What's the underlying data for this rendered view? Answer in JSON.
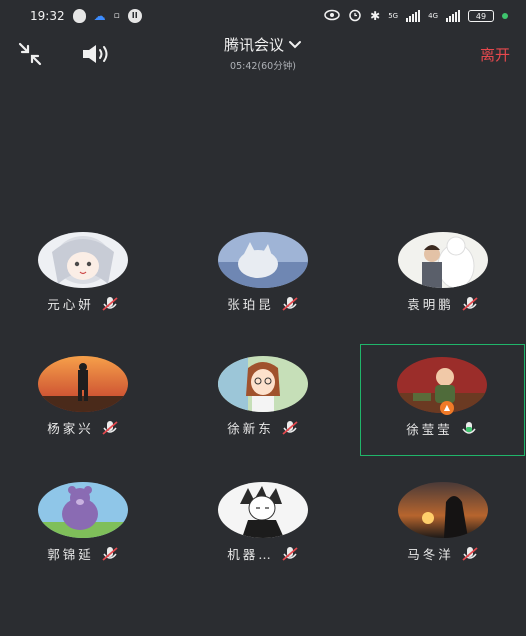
{
  "status_bar": {
    "time": "19:32",
    "network_1": "5G",
    "network_2": "4G",
    "battery": "49"
  },
  "header": {
    "title": "腾讯会议",
    "duration": "05:42(60分钟)",
    "leave_label": "离开"
  },
  "participants": [
    {
      "name": "元心妍",
      "muted": true,
      "speaking": false
    },
    {
      "name": "张珀昆",
      "muted": true,
      "speaking": false
    },
    {
      "name": "袁明鹏",
      "muted": true,
      "speaking": false
    },
    {
      "name": "杨家兴",
      "muted": true,
      "speaking": false
    },
    {
      "name": "徐新东",
      "muted": true,
      "speaking": false
    },
    {
      "name": "徐莹莹",
      "muted": false,
      "speaking": true
    },
    {
      "name": "郭锦延",
      "muted": true,
      "speaking": false
    },
    {
      "name": "机器…",
      "muted": true,
      "speaking": false
    },
    {
      "name": "马冬洋",
      "muted": true,
      "speaking": false
    }
  ],
  "colors": {
    "background": "#2b2d31",
    "leave": "#e5484d",
    "active_border": "#20b56a",
    "mic_active": "#3ec46d"
  }
}
